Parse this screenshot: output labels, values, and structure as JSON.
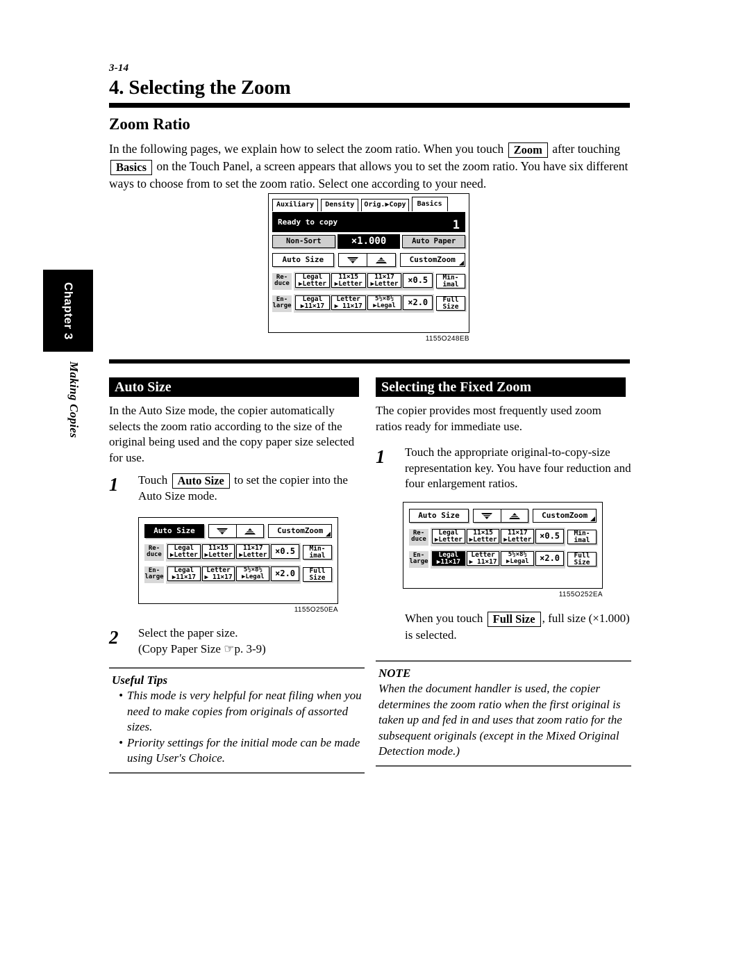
{
  "page": {
    "folio": "3-14",
    "chapter_title": "4. Selecting the Zoom",
    "side_tab": "Chapter 3",
    "side_running_head": "Making Copies",
    "section_title": "Zoom Ratio"
  },
  "intro": {
    "part1": "In the following pages, we explain how to select the zoom ratio. When you touch",
    "key_zoom": "Zoom",
    "part2": "after touching",
    "key_basics": "Basics",
    "part3": "on the Touch Panel, a screen appears that allows you to set the zoom ratio. You have six different ways to choose from to set the zoom ratio. Select one according to your need."
  },
  "figure1": {
    "caption": "1155O248EB",
    "tabs": [
      "Auxiliary",
      "Density",
      "Orig.▶Copy",
      "Basics"
    ],
    "active_tab": "Basics",
    "status_message": "Ready to copy",
    "copy_count": "1",
    "sort_key": "Non-Sort",
    "zoom_display": "×1.000",
    "paper_key": "Auto Paper",
    "auto_size_key": "Auto Size",
    "auto_size_selected": false,
    "zoom_down_icon": "zoom-down-triangle-icon",
    "zoom_up_icon": "zoom-up-triangle-icon",
    "custom_zoom_key": "CustomZoom",
    "reduce_label": "Re-\nduce",
    "enlarge_label": "En-\nlarge",
    "reduce_keys": [
      {
        "l1": "Legal",
        "l2": "▶Letter"
      },
      {
        "l1": "11×15",
        "l2": "▶Letter"
      },
      {
        "l1": "11×17",
        "l2": "▶Letter"
      },
      {
        "l1": "×0.5",
        "l2": ""
      }
    ],
    "reduce_end_key": {
      "l1": "Min-",
      "l2": "imal"
    },
    "enlarge_keys": [
      {
        "l1": "Legal",
        "l2": "▶11×17"
      },
      {
        "l1": "Letter",
        "l2": "▶ 11×17"
      },
      {
        "l1": "5½×8½",
        "l2": "▶Legal"
      },
      {
        "l1": "×2.0",
        "l2": ""
      }
    ],
    "enlarge_end_key": {
      "l1": "Full",
      "l2": "Size"
    },
    "selected_key": ""
  },
  "auto_size": {
    "heading": "Auto Size",
    "paragraph": "In the Auto Size mode, the copier automatically selects the zoom ratio according to the size of the original being used and the copy paper size selected for use.",
    "step1_num": "1",
    "step1_a": "Touch",
    "step1_key": "Auto Size",
    "step1_b": "to set the copier into the Auto Size mode.",
    "step2_num": "2",
    "step2_l1": "Select the paper size.",
    "step2_l2": "(Copy Paper Size ☞p. 3-9)",
    "tips_heading": "Useful Tips",
    "tips": [
      "This mode is very helpful for neat filing when you need to make copies from originals of assorted sizes.",
      "Priority settings for the initial mode can be made using User's Choice."
    ]
  },
  "figure2": {
    "caption": "1155O250EA",
    "auto_size_key": "Auto Size",
    "auto_size_selected": true,
    "custom_zoom_key": "CustomZoom",
    "reduce_label": "Re-\nduce",
    "enlarge_label": "En-\nlarge",
    "reduce_keys": [
      {
        "l1": "Legal",
        "l2": "▶Letter"
      },
      {
        "l1": "11×15",
        "l2": "▶Letter"
      },
      {
        "l1": "11×17",
        "l2": "▶Letter"
      },
      {
        "l1": "×0.5",
        "l2": ""
      }
    ],
    "reduce_end_key": {
      "l1": "Min-",
      "l2": "imal"
    },
    "enlarge_keys": [
      {
        "l1": "Legal",
        "l2": "▶11×17"
      },
      {
        "l1": "Letter",
        "l2": "▶ 11×17"
      },
      {
        "l1": "5½×8½",
        "l2": "▶Legal"
      },
      {
        "l1": "×2.0",
        "l2": ""
      }
    ],
    "enlarge_end_key": {
      "l1": "Full",
      "l2": "Size"
    },
    "selected_key": "auto-size"
  },
  "fixed_zoom": {
    "heading": "Selecting the Fixed Zoom",
    "paragraph": "The copier provides most frequently used zoom ratios ready for immediate use.",
    "step1_num": "1",
    "step1_text": "Touch the appropriate original-to-copy-size representation key. You have four reduction and four enlargement ratios.",
    "fullsize_a": "When you touch",
    "fullsize_key": "Full Size",
    "fullsize_b": ", full size (×1.000) is selected.",
    "note_heading": "NOTE",
    "note_text": "When the document handler is used, the copier determines the zoom ratio when the first original is taken up and fed in and uses that zoom ratio for the subsequent originals (except in the Mixed Original Detection mode.)"
  },
  "figure3": {
    "caption": "1155O252EA",
    "auto_size_key": "Auto Size",
    "auto_size_selected": false,
    "custom_zoom_key": "CustomZoom",
    "reduce_label": "Re-\nduce",
    "enlarge_label": "En-\nlarge",
    "reduce_keys": [
      {
        "l1": "Legal",
        "l2": "▶Letter"
      },
      {
        "l1": "11×15",
        "l2": "▶Letter"
      },
      {
        "l1": "11×17",
        "l2": "▶Letter"
      },
      {
        "l1": "×0.5",
        "l2": ""
      }
    ],
    "reduce_end_key": {
      "l1": "Min-",
      "l2": "imal"
    },
    "enlarge_keys": [
      {
        "l1": "Legal",
        "l2": "▶11×17"
      },
      {
        "l1": "Letter",
        "l2": "▶ 11×17"
      },
      {
        "l1": "5½×8½",
        "l2": "▶Legal"
      },
      {
        "l1": "×2.0",
        "l2": ""
      }
    ],
    "enlarge_end_key": {
      "l1": "Full",
      "l2": "Size"
    },
    "selected_key": "enlarge-legal-to-11x17"
  }
}
